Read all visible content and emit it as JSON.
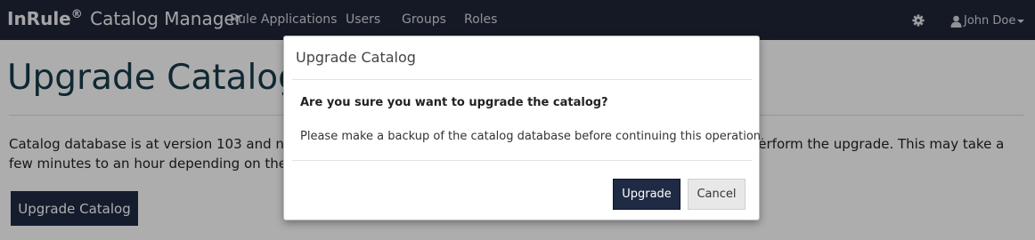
{
  "navbar": {
    "brand_bold": "InRule",
    "brand_mark": "®",
    "brand_rest": "Catalog Manager",
    "items": [
      {
        "label": "Rule Applications"
      },
      {
        "label": "Users"
      },
      {
        "label": "Groups"
      },
      {
        "label": "Roles"
      }
    ],
    "settings_icon": "gear-icon",
    "user_icon": "user-icon",
    "user_name": "John Doe"
  },
  "page": {
    "title": "Upgrade Catalog",
    "message": "Catalog database is at version 103 and needs to be upgraded to version 104. Please click the button below to perform the upgrade. This may take a few minutes to an hour depending on the size of the catalog.",
    "upgrade_button": "Upgrade Catalog"
  },
  "modal": {
    "title": "Upgrade Catalog",
    "question": "Are you sure you want to upgrade the catalog?",
    "note": "Please make a backup of the catalog database before continuing this operation.",
    "confirm_button": "Upgrade",
    "cancel_button": "Cancel"
  },
  "colors": {
    "navbar_bg": "#1f2639",
    "primary_button": "#1f2a44",
    "title_color": "#173b4a"
  }
}
